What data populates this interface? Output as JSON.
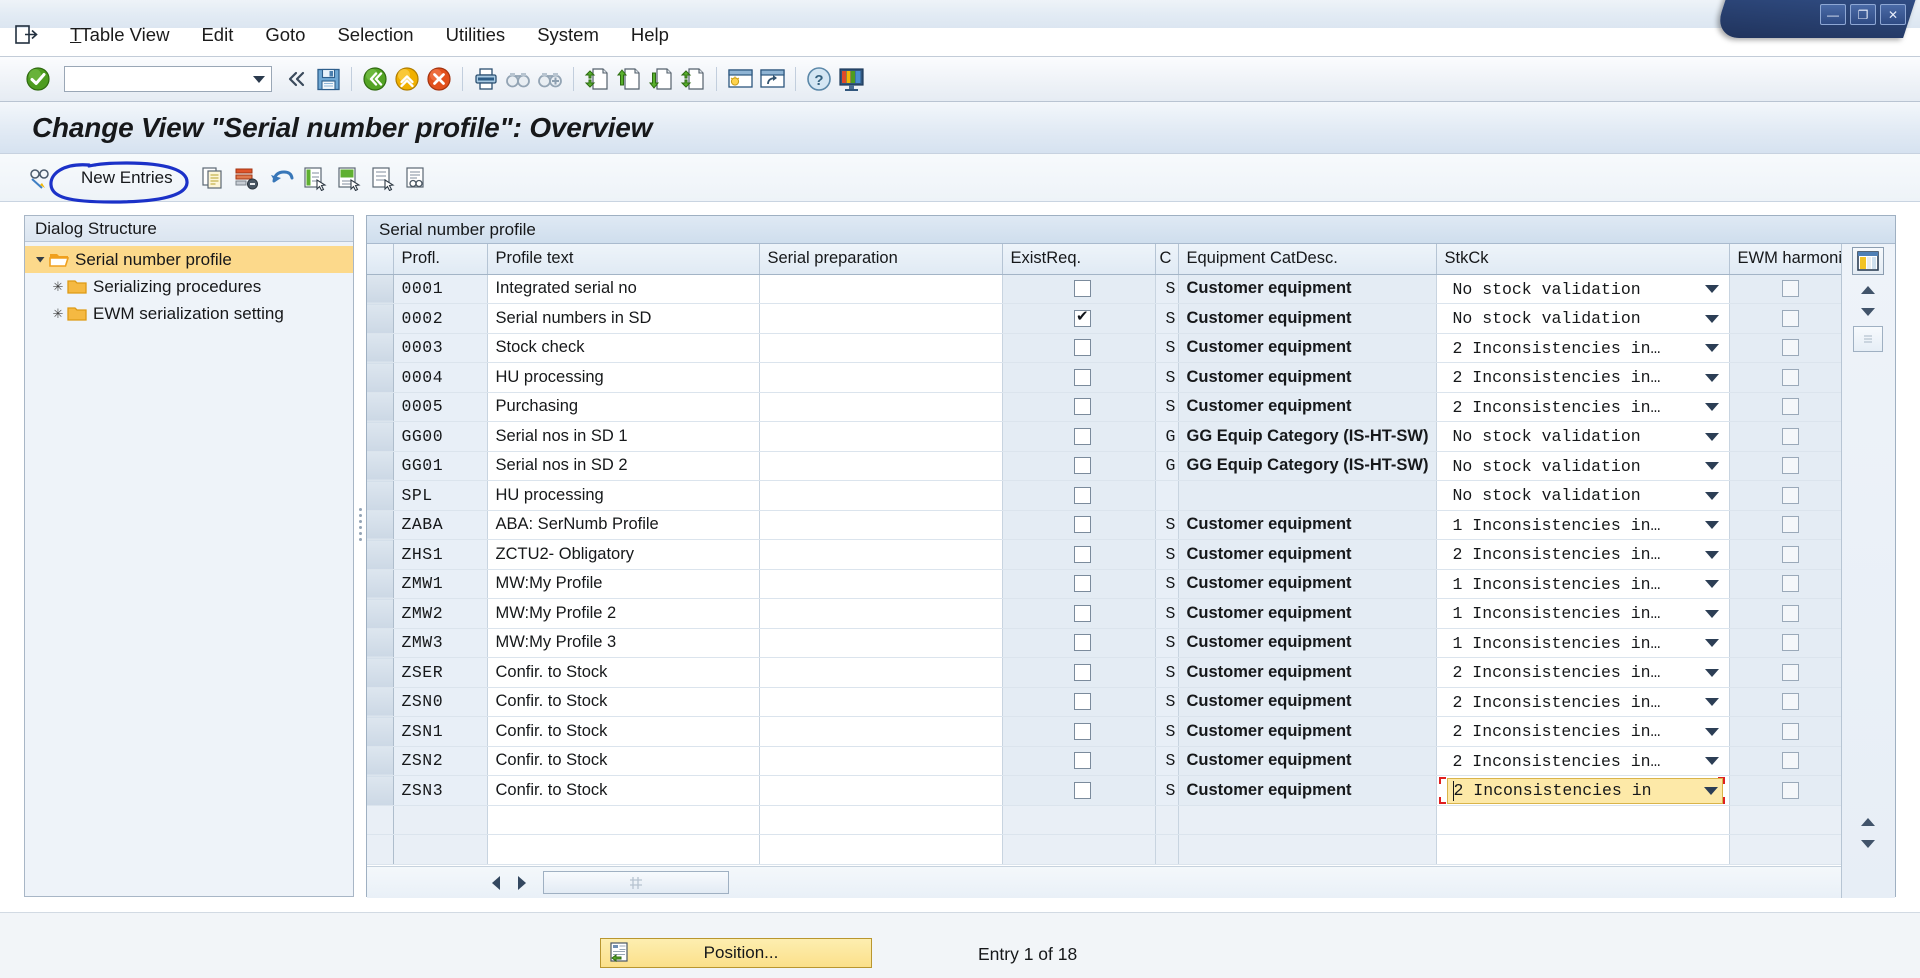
{
  "window": {
    "controls": [
      {
        "name": "minimize",
        "glyph": "—"
      },
      {
        "name": "restore",
        "glyph": "❐"
      },
      {
        "name": "close",
        "glyph": "✕"
      }
    ]
  },
  "menubar": {
    "system_icon": "exit-icon",
    "items": [
      {
        "label": "Table View",
        "accel": "T"
      },
      {
        "label": "Edit",
        "accel": "E"
      },
      {
        "label": "Goto",
        "accel": "G"
      },
      {
        "label": "Selection",
        "accel": "S"
      },
      {
        "label": "Utilities",
        "accel": "U"
      },
      {
        "label": "System",
        "accel": "y"
      },
      {
        "label": "Help",
        "accel": "H"
      }
    ]
  },
  "toolbar": {
    "ok_icon": "ok-check-icon",
    "command_field": {
      "value": "",
      "placeholder": ""
    },
    "items": [
      {
        "name": "collapse-left-icon",
        "title": "Collapse"
      },
      {
        "name": "save-icon",
        "title": "Save"
      },
      {
        "name": "back-icon",
        "title": "Back"
      },
      {
        "name": "exit-icon",
        "title": "Exit"
      },
      {
        "name": "cancel-icon",
        "title": "Cancel"
      },
      {
        "name": "print-icon",
        "title": "Print"
      },
      {
        "name": "find-icon",
        "title": "Find"
      },
      {
        "name": "find-next-icon",
        "title": "Find Next"
      },
      {
        "name": "first-page-icon",
        "title": "First Page"
      },
      {
        "name": "previous-page-icon",
        "title": "Previous Page"
      },
      {
        "name": "next-page-icon",
        "title": "Next Page"
      },
      {
        "name": "last-page-icon",
        "title": "Last Page"
      },
      {
        "name": "new-session-icon",
        "title": "Create New Session"
      },
      {
        "name": "create-shortcut-icon",
        "title": "Create Shortcut"
      },
      {
        "name": "help-icon",
        "title": "Help"
      },
      {
        "name": "customize-layout-icon",
        "title": "Customize Local Layout"
      }
    ]
  },
  "page": {
    "title": "Change View \"Serial number profile\": Overview"
  },
  "apptoolbar": {
    "spectacles_icon": "display-change-icon",
    "new_entries_label": "New Entries",
    "annotation": {
      "shape": "ellipse",
      "color": "#1b31c8",
      "target": "New Entries"
    },
    "items": [
      {
        "name": "copy-as-icon",
        "title": "Copy As..."
      },
      {
        "name": "delete-row-icon",
        "title": "Delete"
      },
      {
        "name": "undo-icon",
        "title": "Undo Change"
      },
      {
        "name": "select-all-icon",
        "title": "Select All"
      },
      {
        "name": "select-block-icon",
        "title": "Select Block"
      },
      {
        "name": "deselect-all-icon",
        "title": "Deselect All"
      },
      {
        "name": "details-icon",
        "title": "Details"
      }
    ]
  },
  "sidebar": {
    "header": "Dialog Structure",
    "items": [
      {
        "label": "Serial number profile",
        "level": 0,
        "selected": true,
        "expanded": true,
        "icon": "open-folder-icon"
      },
      {
        "label": "Serializing procedures",
        "level": 1,
        "selected": false,
        "expanded": false,
        "icon": "folder-icon"
      },
      {
        "label": "EWM serialization setting",
        "level": 1,
        "selected": false,
        "expanded": false,
        "icon": "folder-icon"
      }
    ]
  },
  "table": {
    "caption": "Serial number profile",
    "config_icon": "table-settings-icon",
    "columns": [
      {
        "key": "profl",
        "label": "Profl."
      },
      {
        "key": "text",
        "label": "Profile text"
      },
      {
        "key": "prep",
        "label": "Serial preparation"
      },
      {
        "key": "exist",
        "label": "ExistReq."
      },
      {
        "key": "c",
        "label": "C"
      },
      {
        "key": "cat",
        "label": "Equipment CatDesc."
      },
      {
        "key": "stk",
        "label": "StkCk"
      },
      {
        "key": "ewm",
        "label": "EWM harmoni..."
      }
    ],
    "rows": [
      {
        "profl": "0001",
        "text": "Integrated serial no",
        "prep": "",
        "exist": false,
        "c": "S",
        "cat": "Customer equipment",
        "stk": "No stock validation",
        "ewm": false,
        "focused": false
      },
      {
        "profl": "0002",
        "text": "Serial numbers in SD",
        "prep": "",
        "exist": true,
        "c": "S",
        "cat": "Customer equipment",
        "stk": "No stock validation",
        "ewm": false,
        "focused": false
      },
      {
        "profl": "0003",
        "text": "Stock check",
        "prep": "",
        "exist": false,
        "c": "S",
        "cat": "Customer equipment",
        "stk": "2 Inconsistencies in…",
        "ewm": false,
        "focused": false
      },
      {
        "profl": "0004",
        "text": "HU processing",
        "prep": "",
        "exist": false,
        "c": "S",
        "cat": "Customer equipment",
        "stk": "2 Inconsistencies in…",
        "ewm": false,
        "focused": false
      },
      {
        "profl": "0005",
        "text": "Purchasing",
        "prep": "",
        "exist": false,
        "c": "S",
        "cat": "Customer equipment",
        "stk": "2 Inconsistencies in…",
        "ewm": false,
        "focused": false
      },
      {
        "profl": "GG00",
        "text": "Serial nos in SD 1",
        "prep": "",
        "exist": false,
        "c": "G",
        "cat": "GG Equip Category (IS-HT-SW)",
        "stk": "No stock validation",
        "ewm": false,
        "focused": false
      },
      {
        "profl": "GG01",
        "text": "Serial nos in SD 2",
        "prep": "",
        "exist": false,
        "c": "G",
        "cat": "GG Equip Category (IS-HT-SW)",
        "stk": "No stock validation",
        "ewm": false,
        "focused": false
      },
      {
        "profl": "SPL",
        "text": "HU processing",
        "prep": "",
        "exist": false,
        "c": "",
        "cat": "",
        "stk": "No stock validation",
        "ewm": false,
        "focused": false
      },
      {
        "profl": "ZABA",
        "text": "ABA: SerNumb Profile",
        "prep": "",
        "exist": false,
        "c": "S",
        "cat": "Customer equipment",
        "stk": "1 Inconsistencies in…",
        "ewm": false,
        "focused": false
      },
      {
        "profl": "ZHS1",
        "text": "ZCTU2- Obligatory",
        "prep": "",
        "exist": false,
        "c": "S",
        "cat": "Customer equipment",
        "stk": "2 Inconsistencies in…",
        "ewm": false,
        "focused": false
      },
      {
        "profl": "ZMW1",
        "text": "MW:My Profile",
        "prep": "",
        "exist": false,
        "c": "S",
        "cat": "Customer equipment",
        "stk": "1 Inconsistencies in…",
        "ewm": false,
        "focused": false
      },
      {
        "profl": "ZMW2",
        "text": "MW:My Profile 2",
        "prep": "",
        "exist": false,
        "c": "S",
        "cat": "Customer equipment",
        "stk": "1 Inconsistencies in…",
        "ewm": false,
        "focused": false
      },
      {
        "profl": "ZMW3",
        "text": "MW:My Profile 3",
        "prep": "",
        "exist": false,
        "c": "S",
        "cat": "Customer equipment",
        "stk": "1 Inconsistencies in…",
        "ewm": false,
        "focused": false
      },
      {
        "profl": "ZSER",
        "text": "Confir. to Stock",
        "prep": "",
        "exist": false,
        "c": "S",
        "cat": "Customer equipment",
        "stk": "2 Inconsistencies in…",
        "ewm": false,
        "focused": false
      },
      {
        "profl": "ZSN0",
        "text": "Confir. to Stock",
        "prep": "",
        "exist": false,
        "c": "S",
        "cat": "Customer equipment",
        "stk": "2 Inconsistencies in…",
        "ewm": false,
        "focused": false
      },
      {
        "profl": "ZSN1",
        "text": "Confir. to Stock",
        "prep": "",
        "exist": false,
        "c": "S",
        "cat": "Customer equipment",
        "stk": "2 Inconsistencies in…",
        "ewm": false,
        "focused": false
      },
      {
        "profl": "ZSN2",
        "text": "Confir. to Stock",
        "prep": "",
        "exist": false,
        "c": "S",
        "cat": "Customer equipment",
        "stk": "2 Inconsistencies in…",
        "ewm": false,
        "focused": false
      },
      {
        "profl": "ZSN3",
        "text": "Confir. to Stock",
        "prep": "",
        "exist": false,
        "c": "S",
        "cat": "Customer equipment",
        "stk": "2 Inconsistencies in",
        "ewm": false,
        "focused": true
      }
    ],
    "empty_rows": 2
  },
  "footer": {
    "position_button": {
      "label": "Position...",
      "icon": "position-icon"
    },
    "entry_status": "Entry 1 of 18"
  },
  "colors": {
    "selection_highlight": "#fcd98b",
    "focus_cell_bg": "#fde9a8",
    "focus_bracket": "#e02020",
    "annotation": "#1b31c8",
    "folder": "#f5a623"
  }
}
